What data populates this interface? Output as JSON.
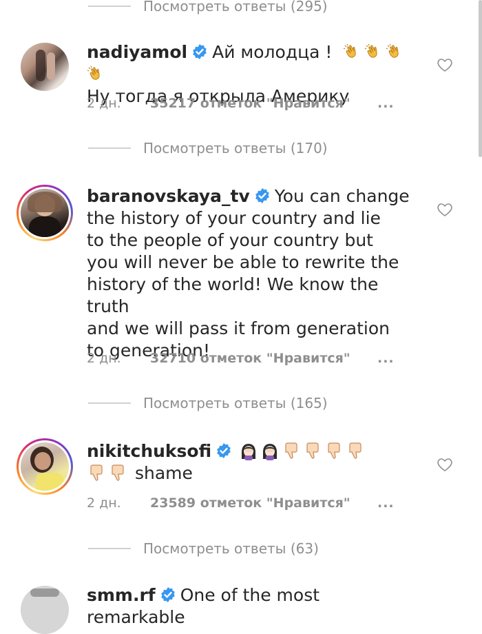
{
  "top_replies": {
    "label": "Посмотреть ответы (295)"
  },
  "comments": [
    {
      "username": "nadiyamol",
      "text_line1": "Ай молодца !",
      "text_rest": "Ну тогда я открыла Америку",
      "time": "2 дн.",
      "likes": "35217 отметок \"Нравится\"",
      "more": "...",
      "replies": "Посмотреть ответы (170)"
    },
    {
      "username": "baranovskaya_tv",
      "text_line1": "You can change",
      "text_rest_lines": [
        "the history of your country and lie",
        "to the people of your country but",
        "you will never be able to rewrite the",
        "history of the world! We know the truth",
        "and we will pass it from generation",
        "to generation!"
      ],
      "time": "2 дн.",
      "likes": "32710 отметок \"Нравится\"",
      "more": "...",
      "replies": "Посмотреть ответы (165)"
    },
    {
      "username": "nikitchuksofi",
      "text_rest": "shame",
      "time": "2 дн.",
      "likes": "23589 отметок \"Нравится\"",
      "more": "...",
      "replies": "Посмотреть ответы (63)"
    },
    {
      "username": "smm.rf",
      "text_line1": "One of the most remarkable"
    }
  ],
  "icons": {
    "verified": "verified-badge-icon",
    "heart": "heart-outline-icon",
    "clap": "clapping-hands-icon",
    "woman": "woman-facepalm-icon",
    "thumbs_down": "thumbs-down-icon"
  },
  "colors": {
    "verified_blue": "#3897f0",
    "meta_gray": "#8e8e8e",
    "text": "#262626"
  }
}
